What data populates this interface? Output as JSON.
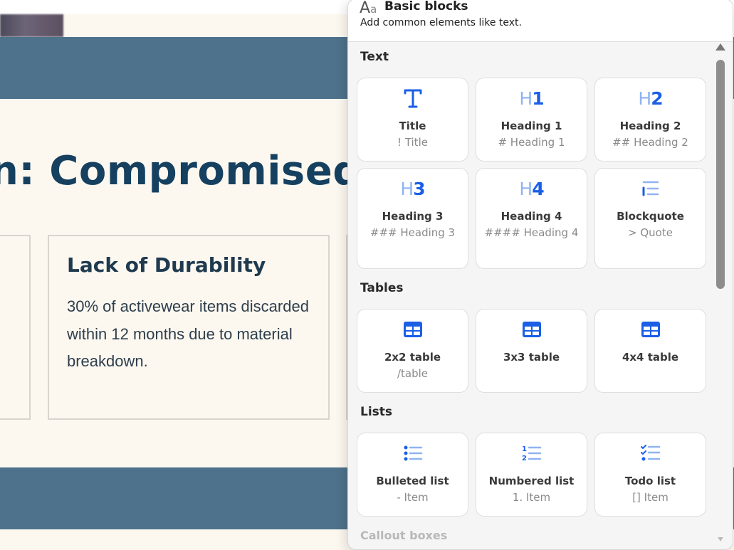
{
  "slide": {
    "title": "n: Compromised A",
    "card": {
      "heading": "Lack of Durability",
      "body": "30% of activewear items discarded within 12 months due to material breakdown."
    },
    "colors": {
      "band": "#4e728b",
      "title": "#16405f",
      "background": "#fcf8f0"
    }
  },
  "popup": {
    "header": {
      "icon": "Aa",
      "title": "Basic blocks",
      "subtitle": "Add common elements like text."
    },
    "sections": [
      {
        "label": "Text",
        "tiles": [
          {
            "icon": "title-icon",
            "name": "Title",
            "hint": "! Title"
          },
          {
            "icon": "heading-1-icon",
            "name": "Heading 1",
            "hint": "# Heading 1"
          },
          {
            "icon": "heading-2-icon",
            "name": "Heading 2",
            "hint": "## Heading 2"
          },
          {
            "icon": "heading-3-icon",
            "name": "Heading 3",
            "hint": "### Heading 3"
          },
          {
            "icon": "heading-4-icon",
            "name": "Heading 4",
            "hint": "#### Heading 4"
          },
          {
            "icon": "blockquote-icon",
            "name": "Blockquote",
            "hint": "> Quote"
          }
        ]
      },
      {
        "label": "Tables",
        "tiles": [
          {
            "icon": "table-icon",
            "name": "2x2 table",
            "hint": "/table"
          },
          {
            "icon": "table-icon",
            "name": "3x3 table",
            "hint": ""
          },
          {
            "icon": "table-icon",
            "name": "4x4 table",
            "hint": ""
          }
        ]
      },
      {
        "label": "Lists",
        "tiles": [
          {
            "icon": "bulleted-list-icon",
            "name": "Bulleted list",
            "hint": "- Item"
          },
          {
            "icon": "numbered-list-icon",
            "name": "Numbered list",
            "hint": "1. Item"
          },
          {
            "icon": "todo-list-icon",
            "name": "Todo list",
            "hint": "[] Item"
          }
        ]
      },
      {
        "label": "Callout boxes",
        "tiles": []
      }
    ],
    "colors": {
      "accent": "#1a5fe6",
      "accent_light": "#8fb3f2"
    }
  }
}
